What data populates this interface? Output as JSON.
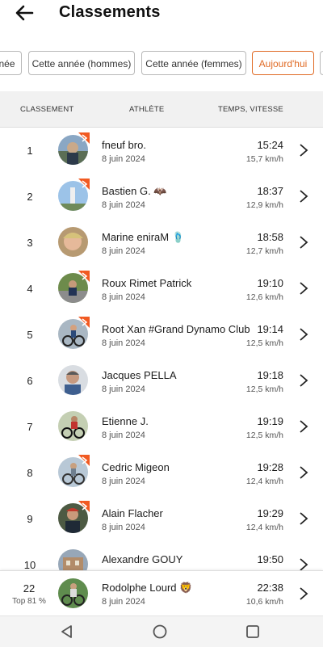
{
  "header": {
    "title": "Classements",
    "back_icon": "arrow-left-icon"
  },
  "filters": [
    {
      "label": "née",
      "active": false
    },
    {
      "label": "Cette année (hommes)",
      "active": false
    },
    {
      "label": "Cette année (femmes)",
      "active": false
    },
    {
      "label": "Aujourd'hui",
      "active": true
    }
  ],
  "columns": {
    "rank": "CLASSEMENT",
    "athlete": "ATHLÈTE",
    "time_speed": "TEMPS, VITESSE"
  },
  "colors": {
    "accent": "#e06a24",
    "badge": "#f15a22"
  },
  "rows": [
    {
      "rank": "1",
      "name": "fneuf bro.",
      "date": "8 juin 2024",
      "time": "15:24",
      "speed": "15,7 km/h",
      "badge": true
    },
    {
      "rank": "2",
      "name": "Bastien G. 🦇",
      "date": "8 juin 2024",
      "time": "18:37",
      "speed": "12,9 km/h",
      "badge": true
    },
    {
      "rank": "3",
      "name": "Marine eniraM 🩴",
      "date": "8 juin 2024",
      "time": "18:58",
      "speed": "12,7 km/h",
      "badge": false
    },
    {
      "rank": "4",
      "name": "Roux Rimet Patrick",
      "date": "8 juin 2024",
      "time": "19:10",
      "speed": "12,6 km/h",
      "badge": true
    },
    {
      "rank": "5",
      "name": "Root Xan #Grand Dynamo Club",
      "date": "8 juin 2024",
      "time": "19:14",
      "speed": "12,5 km/h",
      "badge": true
    },
    {
      "rank": "6",
      "name": "Jacques PELLA",
      "date": "8 juin 2024",
      "time": "19:18",
      "speed": "12,5 km/h",
      "badge": false
    },
    {
      "rank": "7",
      "name": "Etienne J.",
      "date": "8 juin 2024",
      "time": "19:19",
      "speed": "12,5 km/h",
      "badge": false
    },
    {
      "rank": "8",
      "name": "Cedric Migeon",
      "date": "8 juin 2024",
      "time": "19:28",
      "speed": "12,4 km/h",
      "badge": true
    },
    {
      "rank": "9",
      "name": "Alain Flacher",
      "date": "8 juin 2024",
      "time": "19:29",
      "speed": "12,4 km/h",
      "badge": true
    },
    {
      "rank": "10",
      "name": "Alexandre GOUY",
      "date": "",
      "time": "19:50",
      "speed": "",
      "badge": false
    }
  ],
  "my_entry": {
    "rank": "22",
    "percentile": "Top 81 %",
    "name": "Rodolphe Lourd 🦁",
    "date": "8 juin 2024",
    "time": "22:38",
    "speed": "10,6 km/h"
  },
  "navbar": {
    "back": "triangle-back-icon",
    "home": "circle-home-icon",
    "recents": "square-recents-icon"
  }
}
